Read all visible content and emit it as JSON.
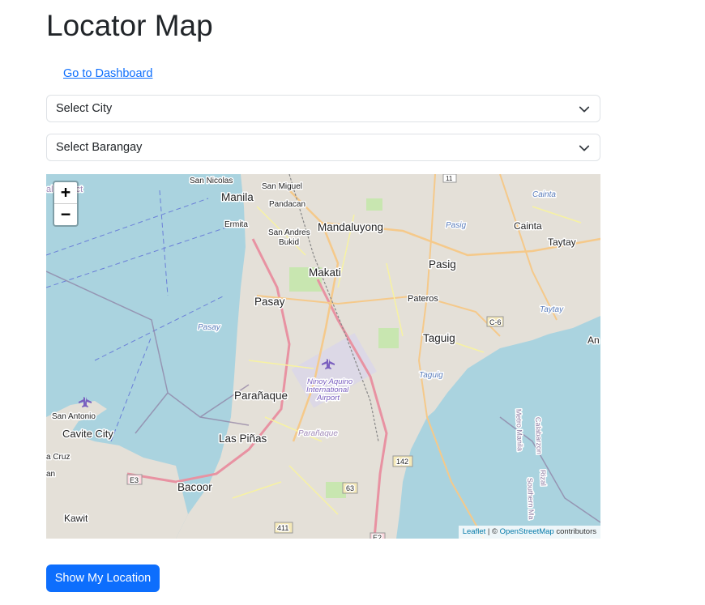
{
  "page": {
    "title": "Locator Map"
  },
  "nav": {
    "dashboard_link": "Go to Dashboard"
  },
  "filters": {
    "city": {
      "selected": "Select City"
    },
    "barangay": {
      "selected": "Select Barangay"
    }
  },
  "map": {
    "zoom_in": "+",
    "zoom_out": "−",
    "attribution": {
      "leaflet": "Leaflet",
      "sep": " | © ",
      "osm": "OpenStreetMap",
      "suffix": " contributors"
    },
    "labels": {
      "manila": "Manila",
      "san_nicolas": "San Nicolas",
      "san_miguel": "San Miguel",
      "pandacan": "Pandacan",
      "ermita": "Ermita",
      "san_andres": "San Andres",
      "bukid": "Bukid",
      "mandaluyong": "Mandaluyong",
      "makati": "Makati",
      "pasig": "Pasig",
      "pasig_river": "Pasig",
      "cainta": "Cainta",
      "cainta_small": "Cainta",
      "taytay": "Taytay",
      "taytay_small": "Taytay",
      "pateros": "Pateros",
      "pasay": "Pasay",
      "pasay_small": "Pasay",
      "taguig": "Taguig",
      "taguig_small": "Taguig",
      "c6": "C-6",
      "an": "An",
      "naia_1": "Ninoy Aquino",
      "naia_2": "International",
      "naia_3": "Airport",
      "paranaque": "Parañaque",
      "paranaque_small": "Parañaque",
      "san_antonio": "San Antonio",
      "cavite_city": "Cavite City",
      "las_pinas": "Las Piñas",
      "a_cruz": "a Cruz",
      "an_west": "an",
      "bacoor": "Bacoor",
      "kawit": "Kawit",
      "district": "al District",
      "r142": "142",
      "r63": "63",
      "r411": "411",
      "e3": "E3",
      "e2": "E2",
      "r11": "11",
      "rizal": "Rizal",
      "gabarzon": "Calabarzon",
      "metro": "Metro Manila",
      "southern": "Southern Ma"
    }
  },
  "actions": {
    "show_location": "Show My Location"
  },
  "colors": {
    "primary": "#0d6efd",
    "water": "#aad3df",
    "land": "#f2efe9",
    "urban": "#e0ddd6"
  }
}
